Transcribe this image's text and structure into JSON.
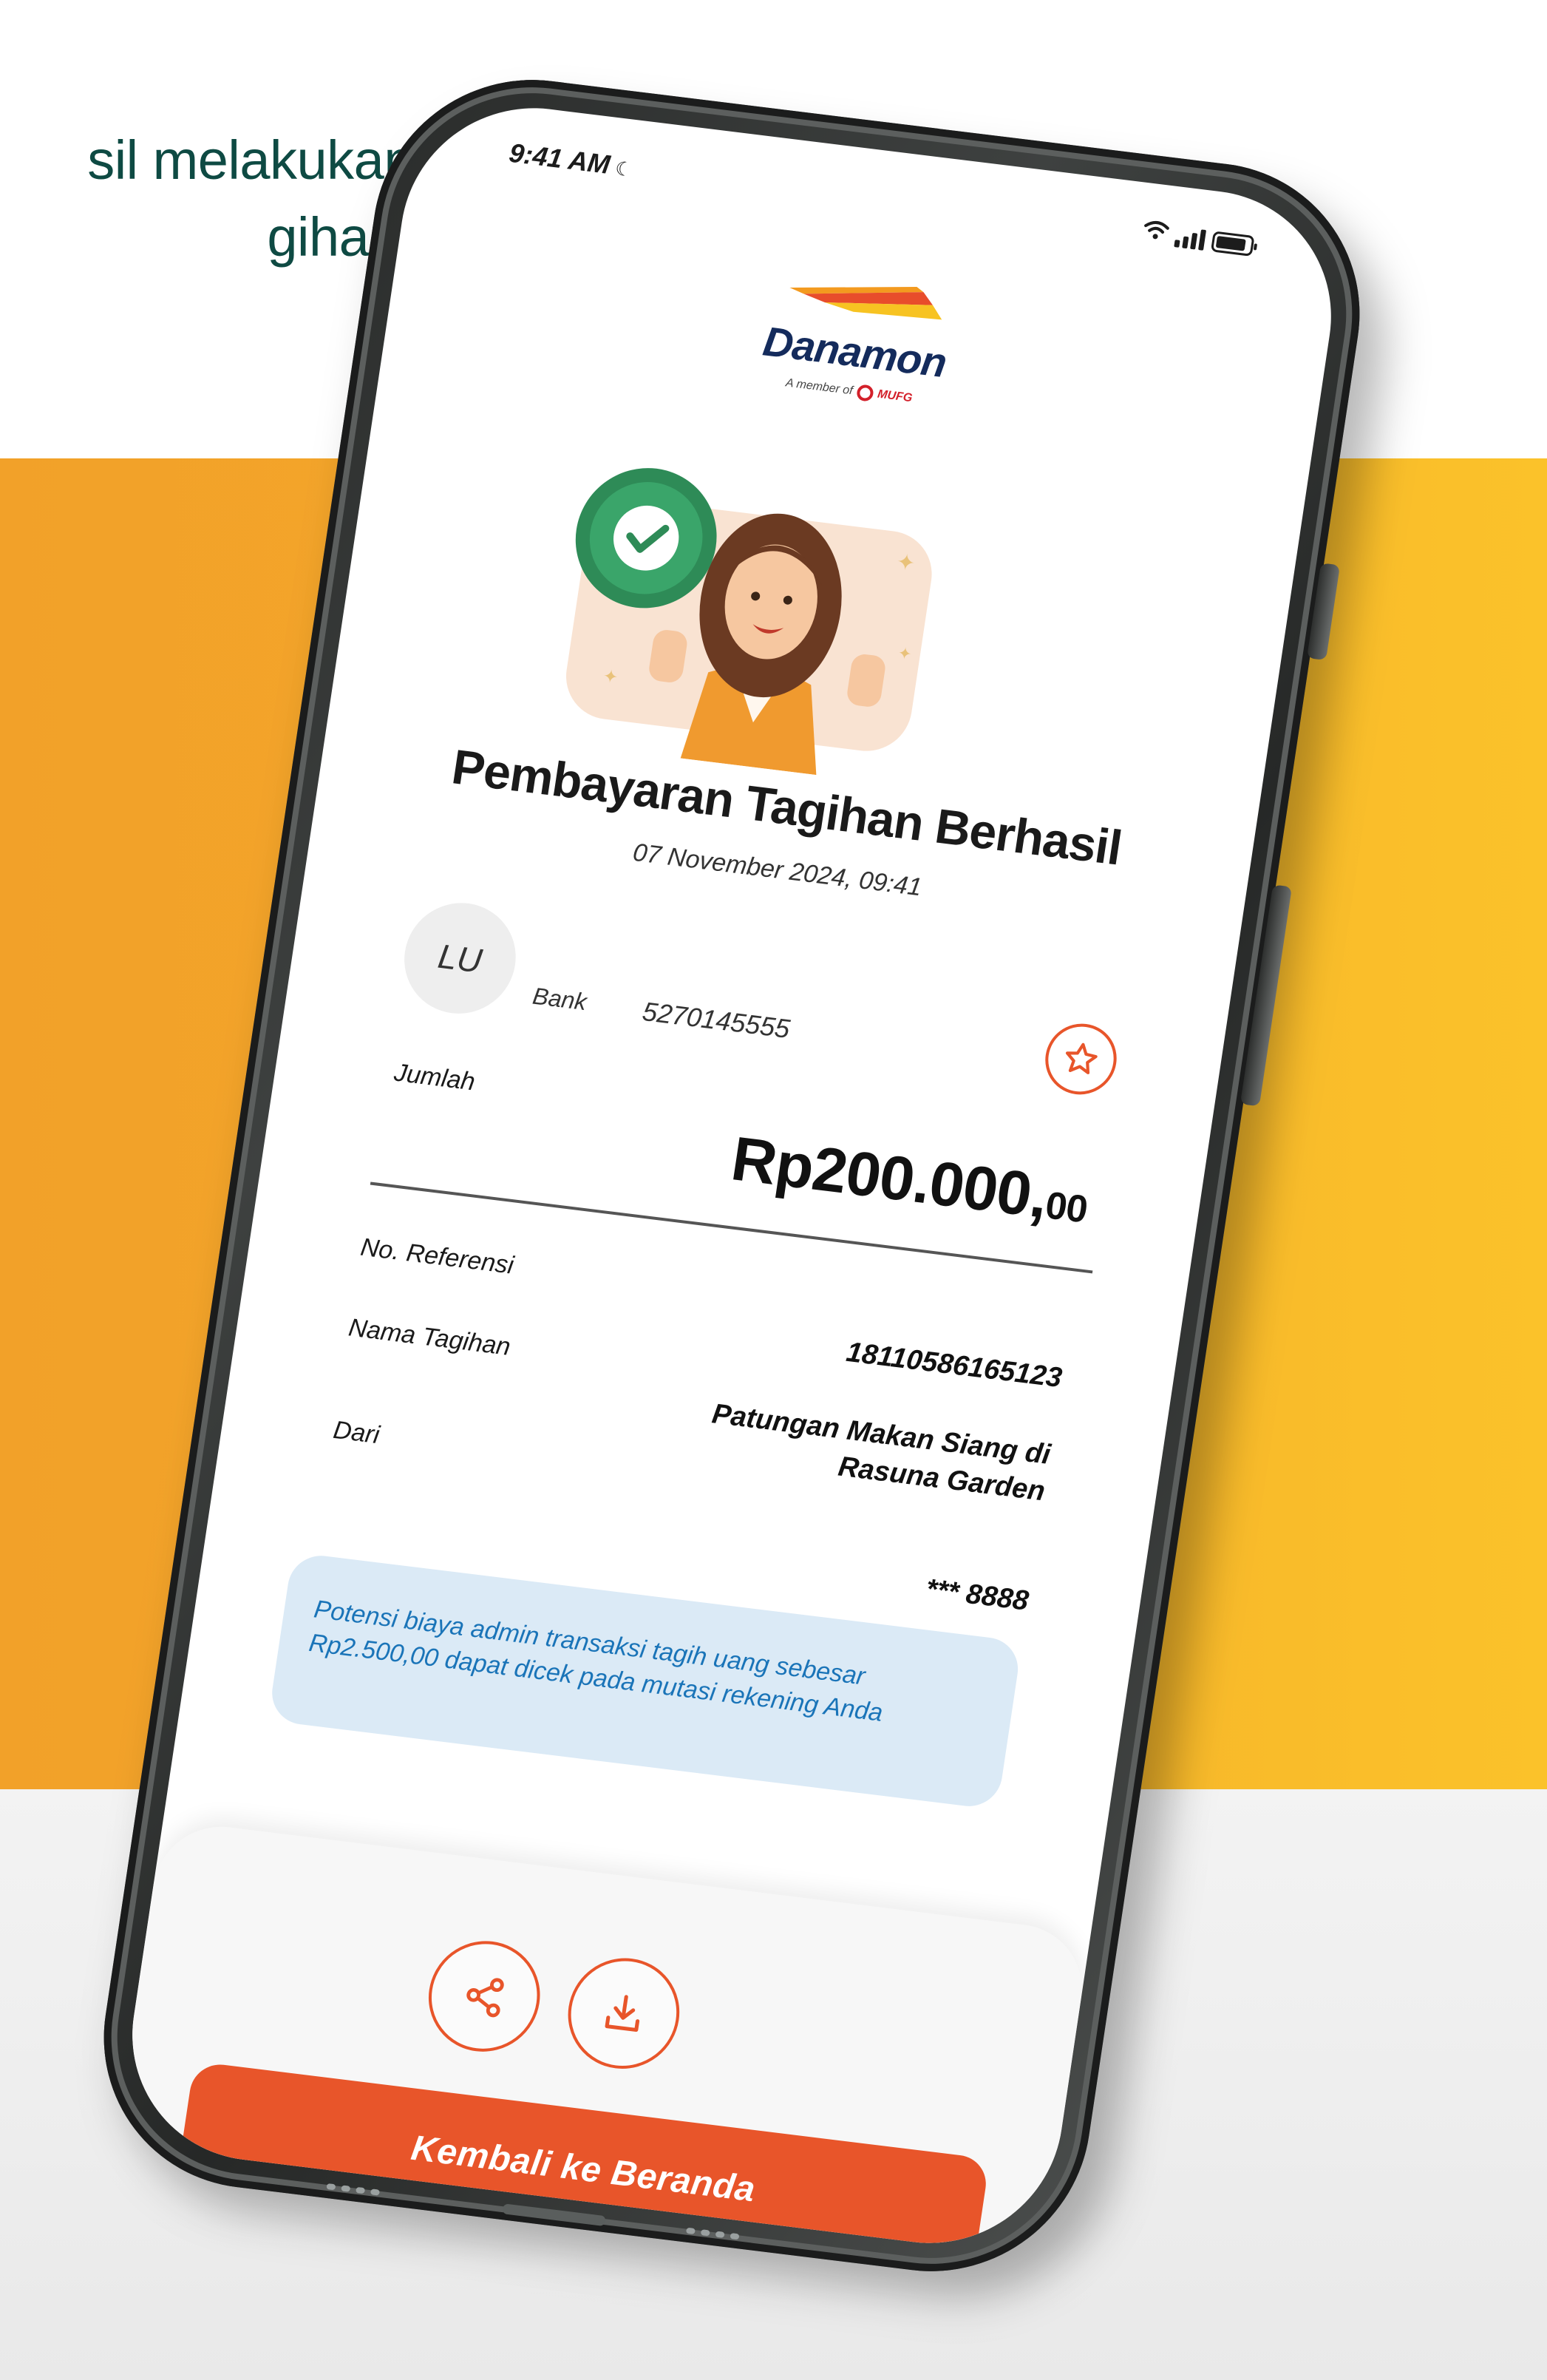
{
  "caption": "sil melakukan\ngihan.",
  "status": {
    "time": "9:41 AM",
    "moon": "☾"
  },
  "logo": {
    "name": "Danamon",
    "member_of": "A member of",
    "mufg": "MUFG"
  },
  "title": "Pembayaran Tagihan Berhasil",
  "datetime": "07 November 2024, 09:41",
  "recipient": {
    "initials": "LU",
    "bank_label": "Bank",
    "account_number": "5270145555"
  },
  "amount": {
    "label": "Jumlah",
    "main": "Rp200.000,",
    "cents": "00"
  },
  "details": {
    "reference_label": "No. Referensi",
    "reference_value": "18110586165123",
    "bill_name_label": "Nama Tagihan",
    "bill_name_value": "Patungan Makan Siang di Rasuna Garden",
    "from_label": "Dari",
    "from_value": "*** 8888"
  },
  "info_note": "Potensi biaya admin transaksi tagih uang sebesar Rp2.500,00 dapat dicek pada mutasi rekening Anda",
  "cta_label": "Kembali ke Beranda",
  "colors": {
    "accent": "#e8552a",
    "brand_navy": "#142b5c",
    "info_bg": "#dbeaf6",
    "info_text": "#1a74b8",
    "caption_green": "#0e4a43",
    "background_orange": "#f4a72a"
  },
  "icons": {
    "favorite": "star-icon",
    "share": "share-icon",
    "download": "download-icon",
    "success": "check-icon"
  }
}
